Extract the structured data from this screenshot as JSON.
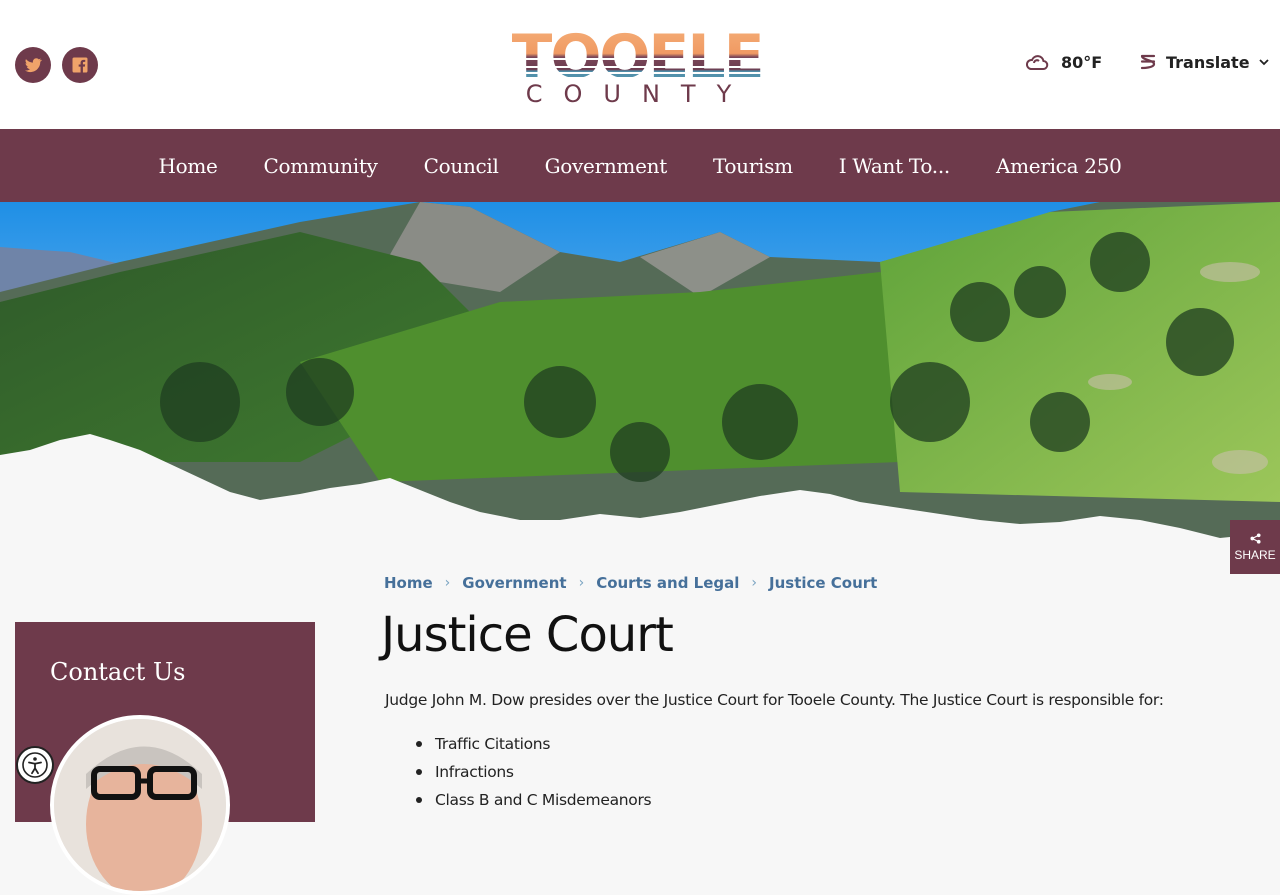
{
  "header": {
    "logo_top": "TOOELE",
    "logo_bottom": "COUNTY",
    "weather": "80°F",
    "translate_label": "Translate"
  },
  "nav": {
    "items": [
      "Home",
      "Community",
      "Council",
      "Government",
      "Tourism",
      "I Want To...",
      "America 250"
    ]
  },
  "share_label": "SHARE",
  "breadcrumb": [
    "Home",
    "Government",
    "Courts and Legal",
    "Justice Court"
  ],
  "page_title": "Justice Court",
  "intro": "Judge John M. Dow presides over the Justice Court for Tooele County. The Justice Court is responsible for:",
  "responsibilities": [
    "Traffic Citations",
    "Infractions",
    "Class B and C Misdemeanors"
  ],
  "sidebar": {
    "contact_title": "Contact Us"
  },
  "colors": {
    "brand": "#6e3a4b",
    "link": "#46709a",
    "logo_orange": "#f0a36a"
  },
  "icons": [
    "twitter-icon",
    "facebook-icon",
    "cloud-icon",
    "translate-icon",
    "chevron-down-icon",
    "share-icon",
    "accessibility-icon"
  ]
}
